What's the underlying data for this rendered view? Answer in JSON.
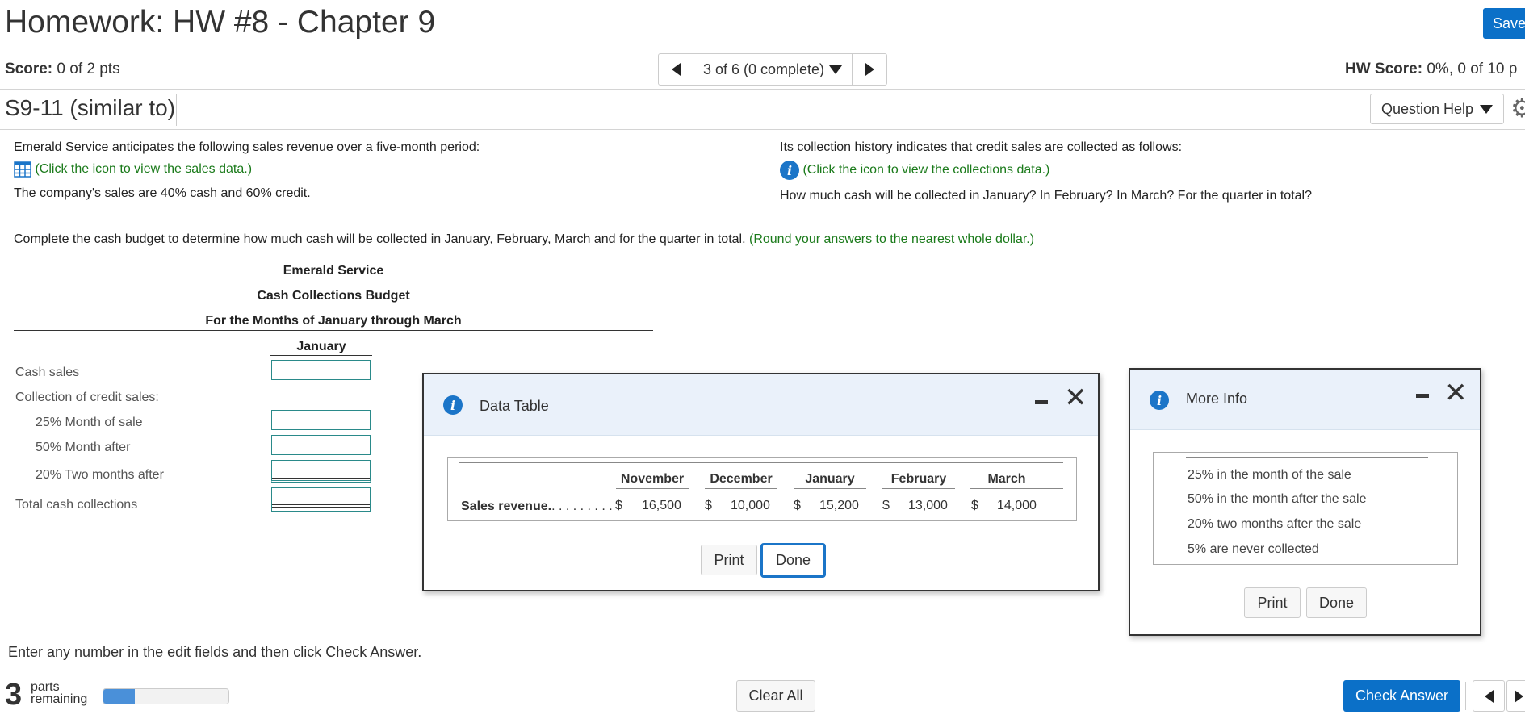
{
  "header": {
    "title": "Homework: HW #8 - Chapter 9",
    "save_label": "Save",
    "score_label": "Score:",
    "score_value": "0 of 2 pts",
    "pager_text": "3 of 6 (0 complete)",
    "hw_score_label": "HW Score:",
    "hw_score_value": "0%, 0 of 10 p"
  },
  "question": {
    "id": "S9-11 (similar to)",
    "help_label": "Question Help"
  },
  "prompt": {
    "left_line1": "Emerald Service anticipates the following sales revenue over a five-month period:",
    "left_link": "(Click the icon to view the sales data.)",
    "left_line3": "The company's sales are 40% cash and 60% credit.",
    "right_line1": "Its collection history indicates that credit sales are collected as follows:",
    "right_link": "(Click the icon to view the collections data.)",
    "right_line3": "How much cash will be collected in January? In February? In March? For the quarter in total?",
    "instruction": "Complete the cash budget to determine how much cash will be collected in January, February, March and for the quarter in total.",
    "instruction_note": "(Round your answers to the nearest whole dollar.)"
  },
  "budget": {
    "company": "Emerald Service",
    "name": "Cash Collections Budget",
    "period": "For the Months of January through March",
    "column": "January",
    "rows": {
      "cash_sales": "Cash sales",
      "collection_credit": "Collection of credit sales:",
      "month_of_sale": "25% Month of sale",
      "month_after": "50% Month after",
      "two_months_after": "20% Two months after",
      "total": "Total cash collections"
    }
  },
  "data_table": {
    "title": "Data Table",
    "columns": [
      "November",
      "December",
      "January",
      "February",
      "March"
    ],
    "row_label": "Sales revenue.",
    "row_dots": ". . . . . . . . .",
    "currency": "$",
    "values": [
      "16,500",
      "10,000",
      "15,200",
      "13,000",
      "14,000"
    ],
    "print_label": "Print",
    "done_label": "Done"
  },
  "more_info": {
    "title": "More Info",
    "items": [
      "25% in the month of the sale",
      "50% in the month after the sale",
      "20% two months after the sale",
      "5% are never collected"
    ],
    "print_label": "Print",
    "done_label": "Done"
  },
  "footer": {
    "hint": "Enter any number in the edit fields and then click Check Answer.",
    "parts_count": "3",
    "parts_word1": "parts",
    "parts_word2": "remaining",
    "progress_fraction": 0.25,
    "clear_label": "Clear All",
    "check_label": "Check Answer"
  },
  "colors": {
    "accent": "#0b70c8",
    "link_green": "#1a7a1a",
    "info_blue": "#1b75c8"
  },
  "icons": [
    "grid-icon",
    "info-icon",
    "gear-icon",
    "minimize-icon",
    "close-icon",
    "caret-down-icon",
    "arrow-left-icon",
    "arrow-right-icon"
  ]
}
